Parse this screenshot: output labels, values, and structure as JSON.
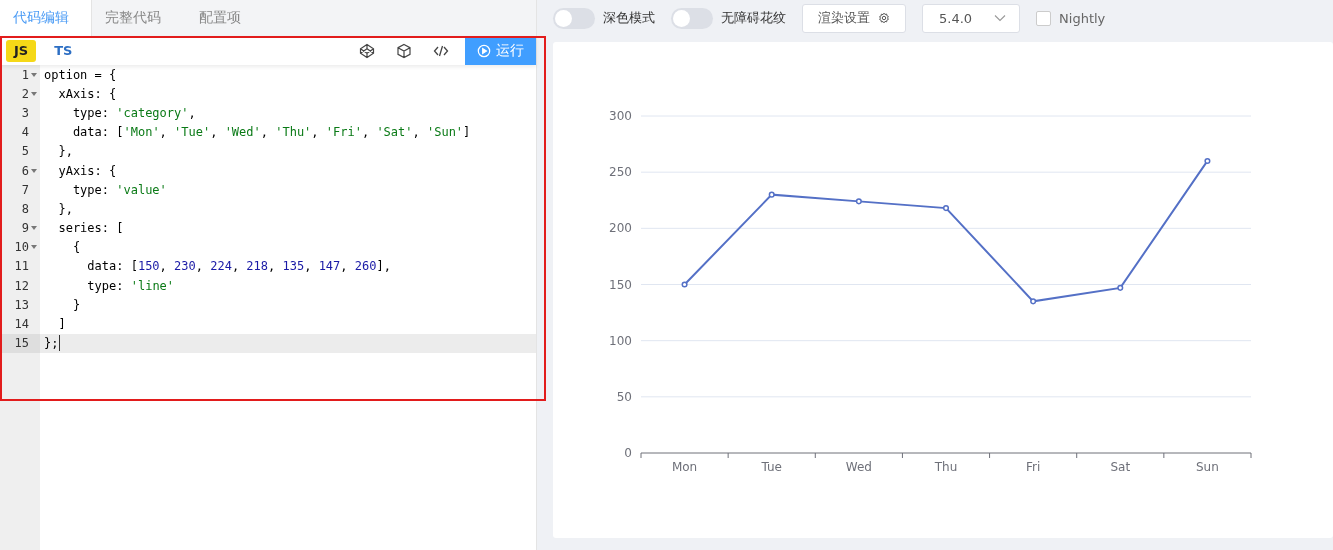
{
  "left_tabs": [
    {
      "label": "代码编辑",
      "selected": true
    },
    {
      "label": "完整代码",
      "selected": false
    },
    {
      "label": "配置项",
      "selected": false
    }
  ],
  "languages": [
    {
      "label": "JS",
      "selected": true
    },
    {
      "label": "TS",
      "selected": false
    }
  ],
  "run_button": "运行",
  "code": [
    {
      "number": "1",
      "foldable": true,
      "active": false,
      "tokens": [
        {
          "kind": "plain",
          "text": "option = {"
        }
      ]
    },
    {
      "number": "2",
      "foldable": true,
      "active": false,
      "tokens": [
        {
          "kind": "plain",
          "text": "  xAxis: {"
        }
      ]
    },
    {
      "number": "3",
      "foldable": false,
      "active": false,
      "tokens": [
        {
          "kind": "plain",
          "text": "    type: "
        },
        {
          "kind": "string",
          "text": "'category'"
        },
        {
          "kind": "plain",
          "text": ","
        }
      ]
    },
    {
      "number": "4",
      "foldable": false,
      "active": false,
      "tokens": [
        {
          "kind": "plain",
          "text": "    data: ["
        },
        {
          "kind": "string",
          "text": "'Mon'"
        },
        {
          "kind": "plain",
          "text": ", "
        },
        {
          "kind": "string",
          "text": "'Tue'"
        },
        {
          "kind": "plain",
          "text": ", "
        },
        {
          "kind": "string",
          "text": "'Wed'"
        },
        {
          "kind": "plain",
          "text": ", "
        },
        {
          "kind": "string",
          "text": "'Thu'"
        },
        {
          "kind": "plain",
          "text": ", "
        },
        {
          "kind": "string",
          "text": "'Fri'"
        },
        {
          "kind": "plain",
          "text": ", "
        },
        {
          "kind": "string",
          "text": "'Sat'"
        },
        {
          "kind": "plain",
          "text": ", "
        },
        {
          "kind": "string",
          "text": "'Sun'"
        },
        {
          "kind": "plain",
          "text": "]"
        }
      ]
    },
    {
      "number": "5",
      "foldable": false,
      "active": false,
      "tokens": [
        {
          "kind": "plain",
          "text": "  },"
        }
      ]
    },
    {
      "number": "6",
      "foldable": true,
      "active": false,
      "tokens": [
        {
          "kind": "plain",
          "text": "  yAxis: {"
        }
      ]
    },
    {
      "number": "7",
      "foldable": false,
      "active": false,
      "tokens": [
        {
          "kind": "plain",
          "text": "    type: "
        },
        {
          "kind": "string",
          "text": "'value'"
        }
      ]
    },
    {
      "number": "8",
      "foldable": false,
      "active": false,
      "tokens": [
        {
          "kind": "plain",
          "text": "  },"
        }
      ]
    },
    {
      "number": "9",
      "foldable": true,
      "active": false,
      "tokens": [
        {
          "kind": "plain",
          "text": "  series: ["
        }
      ]
    },
    {
      "number": "10",
      "foldable": true,
      "active": false,
      "tokens": [
        {
          "kind": "plain",
          "text": "    {"
        }
      ]
    },
    {
      "number": "11",
      "foldable": false,
      "active": false,
      "tokens": [
        {
          "kind": "plain",
          "text": "      data: ["
        },
        {
          "kind": "number",
          "text": "150"
        },
        {
          "kind": "plain",
          "text": ", "
        },
        {
          "kind": "number",
          "text": "230"
        },
        {
          "kind": "plain",
          "text": ", "
        },
        {
          "kind": "number",
          "text": "224"
        },
        {
          "kind": "plain",
          "text": ", "
        },
        {
          "kind": "number",
          "text": "218"
        },
        {
          "kind": "plain",
          "text": ", "
        },
        {
          "kind": "number",
          "text": "135"
        },
        {
          "kind": "plain",
          "text": ", "
        },
        {
          "kind": "number",
          "text": "147"
        },
        {
          "kind": "plain",
          "text": ", "
        },
        {
          "kind": "number",
          "text": "260"
        },
        {
          "kind": "plain",
          "text": "],"
        }
      ]
    },
    {
      "number": "12",
      "foldable": false,
      "active": false,
      "tokens": [
        {
          "kind": "plain",
          "text": "      type: "
        },
        {
          "kind": "string",
          "text": "'line'"
        }
      ]
    },
    {
      "number": "13",
      "foldable": false,
      "active": false,
      "tokens": [
        {
          "kind": "plain",
          "text": "    }"
        }
      ]
    },
    {
      "number": "14",
      "foldable": false,
      "active": false,
      "tokens": [
        {
          "kind": "plain",
          "text": "  ]"
        }
      ]
    },
    {
      "number": "15",
      "foldable": false,
      "active": true,
      "tokens": [
        {
          "kind": "plain",
          "text": "};"
        }
      ]
    }
  ],
  "toolbar": {
    "toggles": [
      {
        "label": "深色模式",
        "on": false
      },
      {
        "label": "无障碍花纹",
        "on": false
      }
    ],
    "render_settings": "渲染设置",
    "version": "5.4.0",
    "nightly": {
      "label": "Nightly",
      "checked": false
    }
  },
  "chart": {
    "chart_data": {
      "type": "line",
      "categories": [
        "Mon",
        "Tue",
        "Wed",
        "Thu",
        "Fri",
        "Sat",
        "Sun"
      ],
      "series": [
        {
          "color": "#5470c6",
          "marker": true,
          "values": [
            150,
            230,
            224,
            218,
            135,
            147,
            260
          ]
        }
      ],
      "ylim": [
        0,
        300
      ],
      "yticks": [
        0,
        50,
        100,
        150,
        200,
        250,
        300
      ],
      "grid": true
    }
  }
}
